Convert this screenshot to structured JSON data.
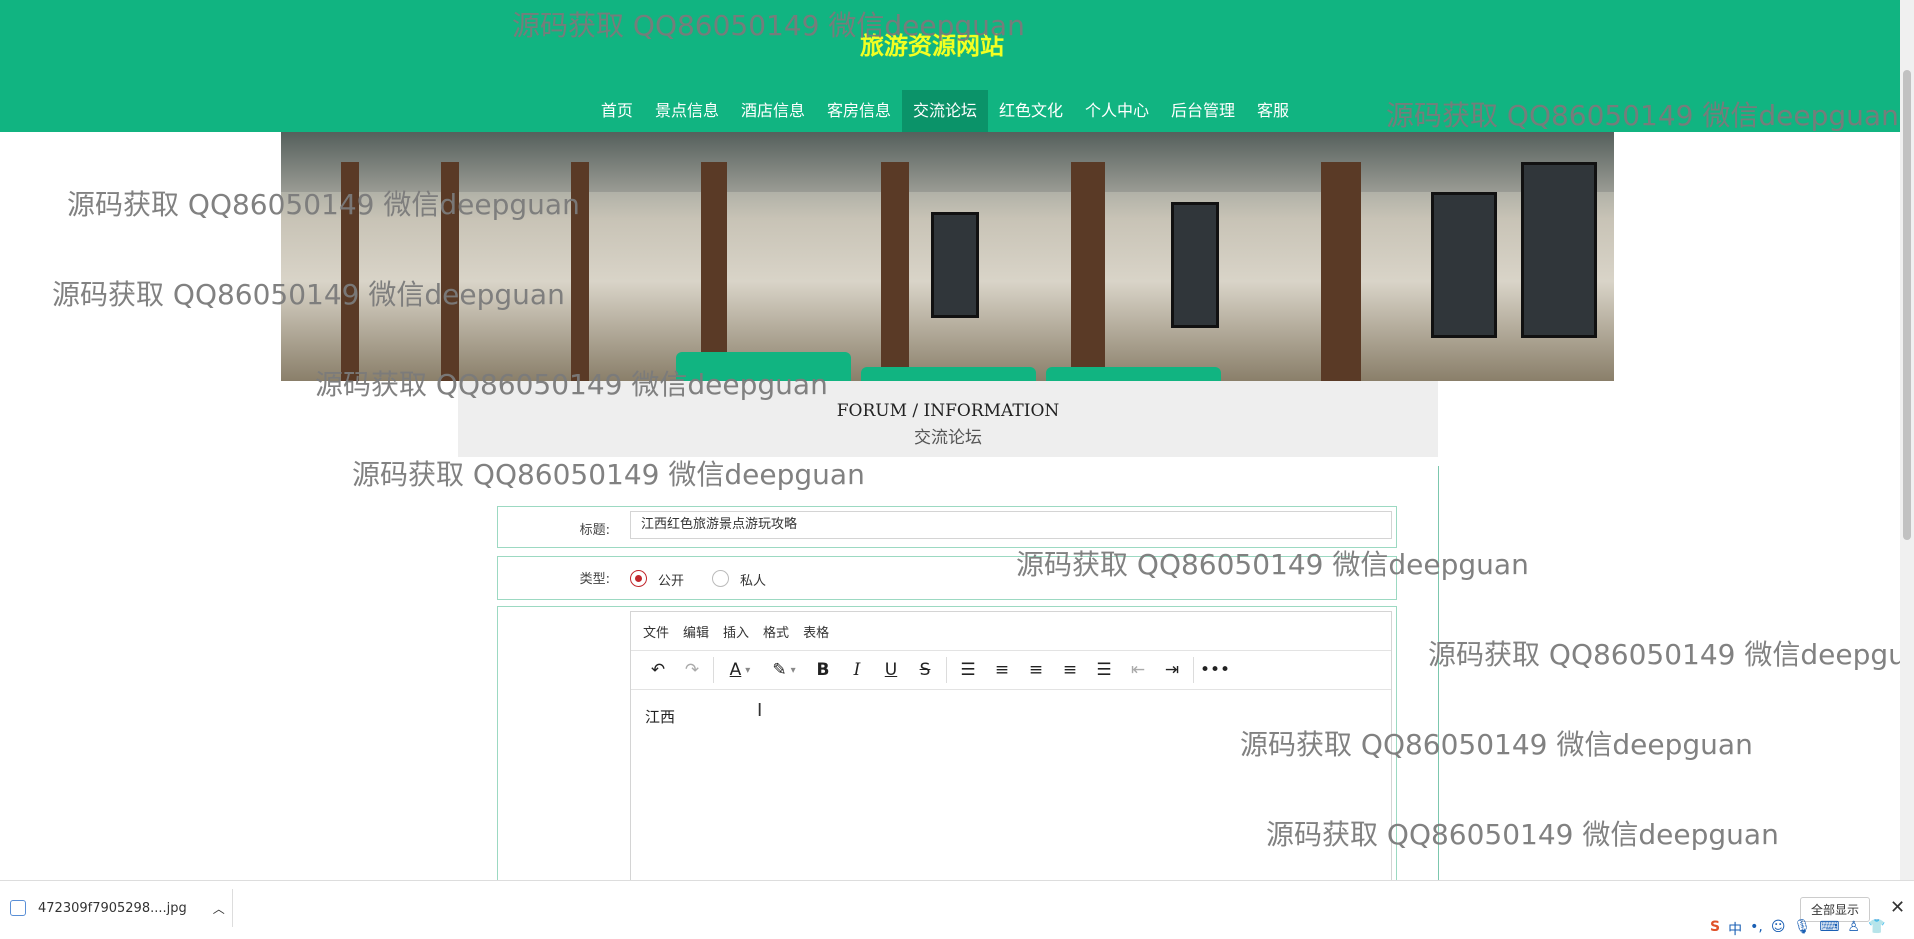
{
  "header": {
    "site_title": "旅游资源网站",
    "nav": [
      "首页",
      "景点信息",
      "酒店信息",
      "客房信息",
      "交流论坛",
      "红色文化",
      "个人中心",
      "后台管理",
      "客服"
    ],
    "active_nav": "交流论坛"
  },
  "section": {
    "title_en": "FORUM / INFORMATION",
    "title_cn": "交流论坛"
  },
  "form": {
    "title_label": "标题:",
    "title_value": "江西红色旅游景点游玩攻略",
    "type_label": "类型:",
    "type_options": [
      "公开",
      "私人"
    ],
    "type_selected": "公开"
  },
  "editor": {
    "menus": [
      "文件",
      "编辑",
      "插入",
      "格式",
      "表格"
    ],
    "toolbar_icons": [
      "undo-icon",
      "redo-icon",
      "font-color-icon",
      "highlight-icon",
      "bold-icon",
      "italic-icon",
      "underline-icon",
      "strikethrough-icon",
      "line-height-icon",
      "align-left-icon",
      "align-center-icon",
      "align-right-icon",
      "align-justify-icon",
      "outdent-icon",
      "indent-icon",
      "more-icon"
    ],
    "content": "江西"
  },
  "watermark": "源码获取 QQ86050149 微信deepguan",
  "download_bar": {
    "file_name": "472309f7905298....jpg",
    "show_all": "全部显示"
  },
  "colors": {
    "header_green": "#11b481",
    "title_yellow": "#f2ff22",
    "radio_red": "#c1272d"
  }
}
